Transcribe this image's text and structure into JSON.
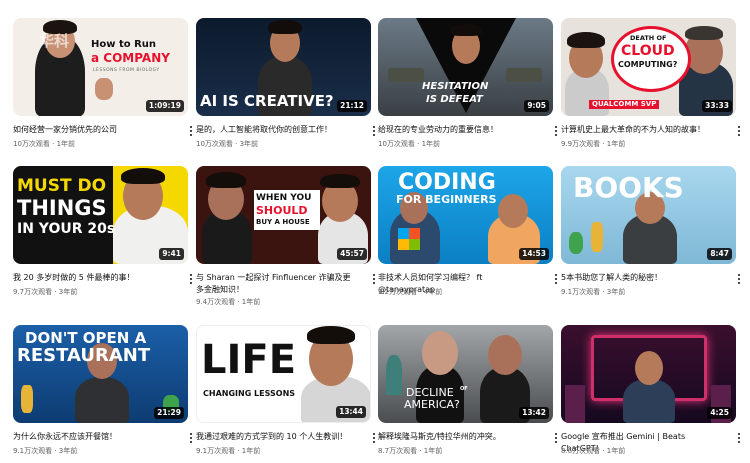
{
  "videos": [
    {
      "title": "如何经营一家分销优先的公司",
      "meta": "10万次观看 · 1年前",
      "duration": "1:09:19",
      "thumb_text_1": "How to Run",
      "thumb_text_2": "a COMPANY",
      "thumb_text_3": "LESSONS FROM BIOLOGY",
      "thumb_logo": "华科"
    },
    {
      "title": "是的，人工智能将取代你的创意工作！",
      "meta": "10万次观看 · 3年前",
      "duration": "21:12",
      "thumb_text_1": "AI IS CREATIVE?"
    },
    {
      "title": "给现在的专业劳动力的重要信息！",
      "meta": "10万次观看 · 1年前",
      "duration": "9:05",
      "thumb_text_1": "HESITATION",
      "thumb_text_2": "IS DEFEAT"
    },
    {
      "title": "计算机史上最大革命的不为人知的故事！",
      "meta": "9.9万次观看 · 1年前",
      "duration": "33:33",
      "thumb_text_1": "DEATH OF",
      "thumb_text_2": "CLOUD",
      "thumb_text_3": "COMPUTING?",
      "thumb_text_4": "QUALCOMM SVP"
    },
    {
      "title": "我 20 多岁时做的 5 件最棒的事！",
      "meta": "9.7万次观看 · 3年前",
      "duration": "9:41",
      "thumb_text_1": "MUST DO",
      "thumb_text_2": "THINGS",
      "thumb_text_3": "IN YOUR 20s"
    },
    {
      "title": "与 Sharan 一起探讨 Finfluencer 诈骗及更多金融知识！",
      "meta": "9.4万次观看 · 1年前",
      "duration": "45:57",
      "thumb_text_1": "WHEN YOU",
      "thumb_text_2": "SHOULD",
      "thumb_text_3": "BUY A HOUSE"
    },
    {
      "title": "非技术人员如何学习编程？ ft @tanaypratap",
      "meta": "9.2万次观看 · 4年前",
      "duration": "14:53",
      "thumb_text_1": "CODING",
      "thumb_text_2": "FOR BEGINNERS"
    },
    {
      "title": "5本书助您了解人类的秘密！",
      "meta": "9.1万次观看 · 3年前",
      "duration": "8:47",
      "thumb_text_1": "BOOKS"
    },
    {
      "title": "为什么你永远不应该开餐馆！",
      "meta": "9.1万次观看 · 3年前",
      "duration": "21:29",
      "thumb_text_1": "DON'T OPEN A",
      "thumb_text_2": "RESTAURANT"
    },
    {
      "title": "我通过艰难的方式学到的 10 个人生教训！",
      "meta": "9.1万次观看 · 1年前",
      "duration": "13:44",
      "thumb_text_1": "LIFE",
      "thumb_text_2": "CHANGING LESSONS"
    },
    {
      "title": "解释埃隆马斯克/特拉华州的冲突。",
      "meta": "8.7万次观看 · 1年前",
      "duration": "13:42",
      "thumb_text_1": "DECLINE",
      "thumb_text_2": "OF",
      "thumb_text_3": "AMERICA?"
    },
    {
      "title": "Google 宣布推出 Gemini | Beats ChatGPT!",
      "meta": "8.6万次观看 · 1年前",
      "duration": "4:25"
    }
  ],
  "colors": {
    "accent_red": "#e8112d",
    "accent_yellow": "#f5d800",
    "accent_green": "#3fd14a",
    "meta_gray": "#606060"
  }
}
